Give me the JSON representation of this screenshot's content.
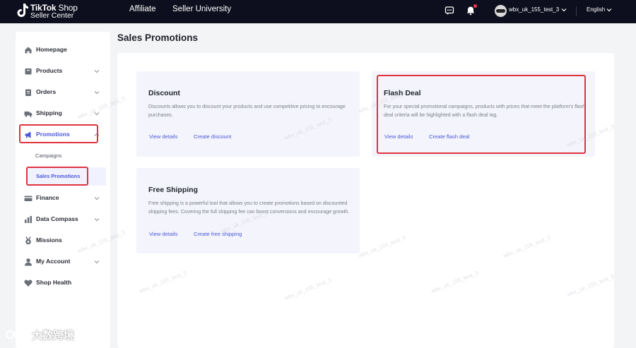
{
  "header": {
    "logo_line1_bold": "TikTok",
    "logo_line1_light": "Shop",
    "logo_line2": "Seller Center",
    "nav": [
      "Affiliate",
      "Seller University"
    ],
    "store_name": "wbx_uk_155_test_3",
    "language": "English",
    "notification_dot_color": "#fe2c55"
  },
  "sidebar": {
    "items": [
      {
        "label": "Homepage",
        "icon": "home-icon"
      },
      {
        "label": "Products",
        "icon": "box-icon"
      },
      {
        "label": "Orders",
        "icon": "orders-icon"
      },
      {
        "label": "Shipping",
        "icon": "truck-icon"
      },
      {
        "label": "Promotions",
        "icon": "megaphone-icon"
      },
      {
        "label": "Finance",
        "icon": "card-icon"
      },
      {
        "label": "Data Compass",
        "icon": "chart-icon"
      },
      {
        "label": "Missions",
        "icon": "medal-icon"
      },
      {
        "label": "My Account",
        "icon": "user-icon"
      },
      {
        "label": "Shop Health",
        "icon": "health-icon"
      }
    ],
    "sub_items": [
      "Campaigns",
      "Sales Promotions"
    ]
  },
  "main": {
    "title": "Sales Promotions",
    "cards": [
      {
        "title": "Discount",
        "description": "Discounts allows you to discount your products and use competitive pricing to encourage purchases.",
        "link_view": "View details",
        "link_create": "Create discount"
      },
      {
        "title": "Flash Deal",
        "description": "For your special promotional campaigns, products with prices that meet the platform's flash deal criteria will be highlighted with a flash deal tag.",
        "link_view": "View details",
        "link_create": "Create flash deal"
      },
      {
        "title": "Free Shipping",
        "description": "Free shipping is a powerful tool that allows you to create promotions based on discounted shipping fees. Covering the full shipping fee can boost conversions and encourage growth.",
        "link_view": "View details",
        "link_create": "Create free shipping"
      }
    ]
  },
  "watermark": {
    "text": "wbx_uk_155_test_3",
    "corner_brand": "大数跨境"
  },
  "colors": {
    "topbar": "#0e0f1e",
    "accent": "#4c57d9",
    "highlight_border": "#e0323e",
    "card_bg": "#f3f4fc"
  }
}
